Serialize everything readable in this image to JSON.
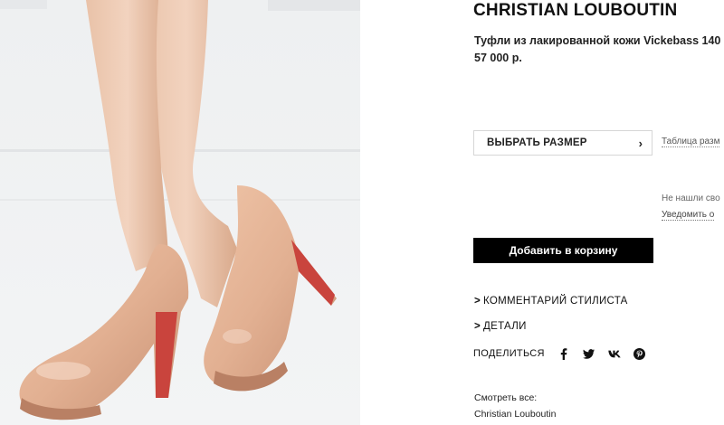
{
  "product": {
    "brand": "CHRISTIAN LOUBOUTIN",
    "name": "Туфли из лакированной кожи Vickebass 140",
    "price": "57 000 р.",
    "image_icon": "product-photo"
  },
  "size": {
    "select_label": "ВЫБРАТЬ РАЗМЕР",
    "chevron": "›",
    "table_link": "Таблица разм",
    "not_found": "Не нашли сво",
    "notify_link": "Уведомить о"
  },
  "cart": {
    "add_label": "Добавить в корзину"
  },
  "sections": [
    {
      "arrow": ">",
      "label": "КОММЕНТАРИЙ СТИЛИСТА"
    },
    {
      "arrow": ">",
      "label": "ДЕТАЛИ"
    }
  ],
  "share": {
    "label": "ПОДЕЛИТЬСЯ",
    "icons": [
      "facebook-icon",
      "twitter-icon",
      "vk-icon",
      "pinterest-icon"
    ]
  },
  "see_all": {
    "label": "Смотреть все:",
    "brand_link": "Christian Louboutin"
  },
  "colors": {
    "button_bg": "#000000",
    "text": "#111111",
    "heel_sole": "#c9443d",
    "nude": "#e2b598"
  }
}
